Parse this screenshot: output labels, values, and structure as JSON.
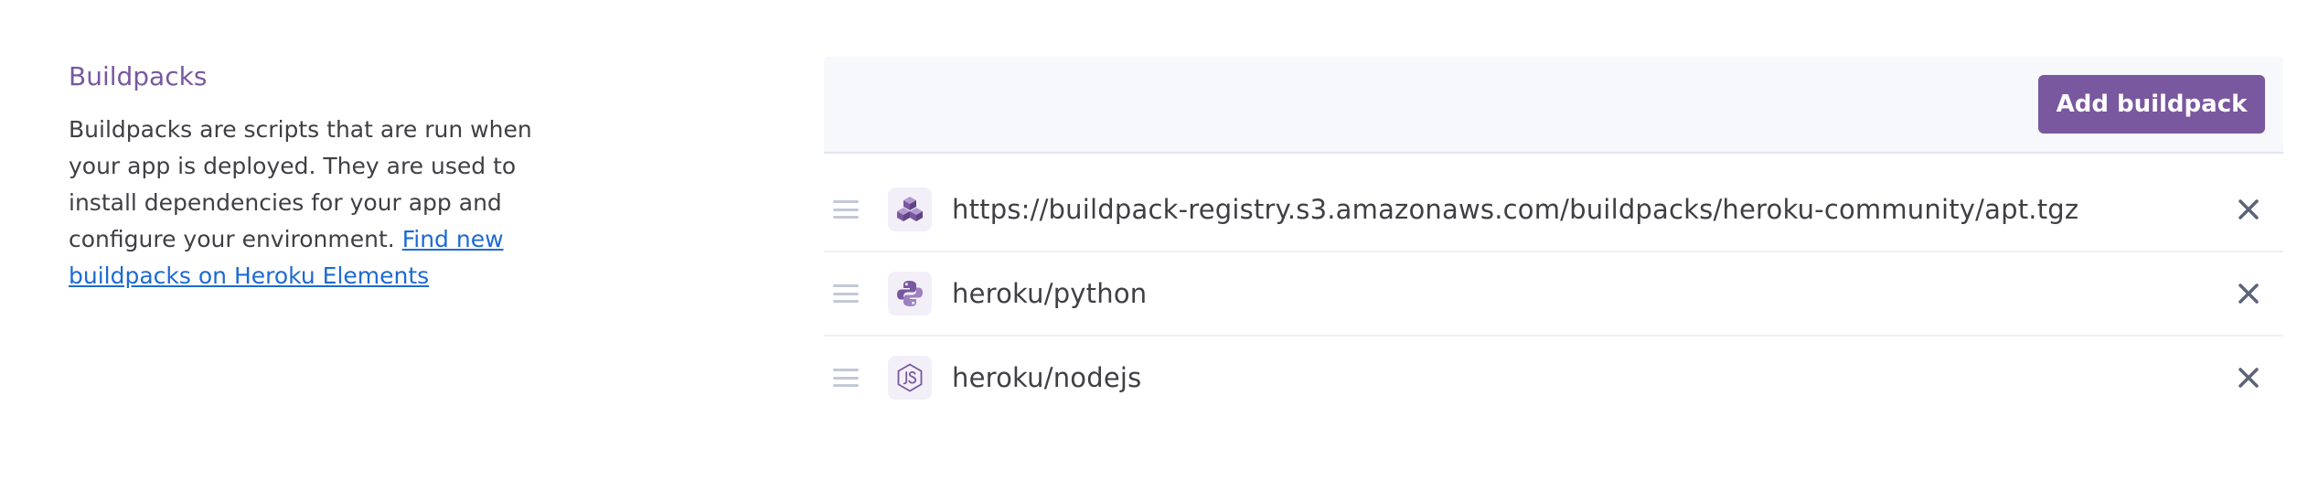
{
  "intro": {
    "title": "Buildpacks",
    "description": "Buildpacks are scripts that are run when your app is deployed. They are used to install dependencies for your app and configure your environment.",
    "link_text": "Find new buildpacks on Heroku Elements"
  },
  "toolbar": {
    "add_label": "Add buildpack"
  },
  "buildpacks": [
    {
      "name": "https://buildpack-registry.s3.amazonaws.com/buildpacks/heroku-community/apt.tgz",
      "icon": "package-boxes-icon"
    },
    {
      "name": "heroku/python",
      "icon": "python-icon"
    },
    {
      "name": "heroku/nodejs",
      "icon": "nodejs-icon"
    }
  ],
  "colors": {
    "accent": "#79589f",
    "link": "#1d6ad3",
    "header_bg": "#f7f8fb",
    "text": "#3f3f44",
    "remove_icon": "#5b6478"
  }
}
